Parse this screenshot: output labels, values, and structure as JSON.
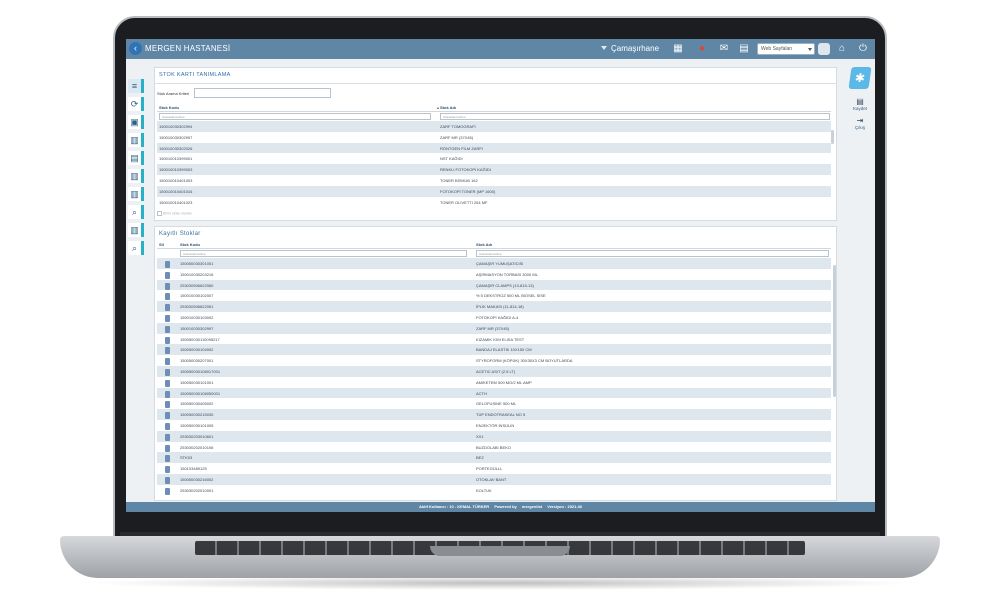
{
  "app": {
    "title": "MERGEN HASTANESİ",
    "department": "Çamaşırhane",
    "service_placeholder": "Web Sayfaları"
  },
  "toolbar": {
    "icons": [
      "calendar-icon",
      "user-icon",
      "mail-icon",
      "chart-icon",
      "home-icon",
      "power-icon"
    ]
  },
  "rightbar": {
    "save_label": "Kaydet",
    "exit_label": "Çıkış"
  },
  "define_panel": {
    "title": "STOK KARTI TANIMLAMA",
    "search_label": "Stok Arama Kriteri",
    "columns": [
      "Stok Kodu",
      "Stok Adı"
    ],
    "filter_placeholder": "Aranacak Kelime",
    "rows": [
      [
        "150010030302994",
        "ZARF TOMOGRAFİ"
      ],
      [
        "150010030302997",
        "ZARF MR (37X45)"
      ],
      [
        "150010030302026",
        "RÖNTGEN FİLM ZARFI"
      ],
      [
        "150010010399001",
        "NST KAĞIDI"
      ],
      [
        "150010010399003",
        "RENKLİ FOTOKOPİ KAĞIDI"
      ],
      [
        "150010010401003",
        "TONER BİSHUB 162"
      ],
      [
        "150010010401016",
        "FOTOKOPİ TONER (MP 1600)"
      ],
      [
        "150010010401023",
        "TONER OLIVETTI 254 MF"
      ]
    ],
    "footer_checkbox": "Birim stoku olanlar"
  },
  "registered_panel": {
    "title": "Kayıtlı Stoklar",
    "columns": [
      "Sil",
      "Stok Kodu",
      "Stok Adı"
    ],
    "filter_placeholder": "Aranacak Kelime",
    "rows": [
      [
        "150050030301001",
        "ÇAMAŞIR YUMUŞATICISI"
      ],
      [
        "150010030203216",
        "AŞIRMASYON TORBASI 3000 ML"
      ],
      [
        "253030506622060",
        "ÇAMAŞIR CLAMPS (13-815-13)"
      ],
      [
        "150010030102007",
        "% 5 DEKSTROZ 500 ML BIOSEL SISE"
      ],
      [
        "253030506622051",
        "İPLİK MAKASI (11-814-18)"
      ],
      [
        "150010030103002",
        "FOTOKOPİ KAĞIDI A-4"
      ],
      [
        "150010030302997",
        "ZARF MR (37X45)"
      ],
      [
        "150050030110095217",
        "KIZAMIK IGM ELISA TEST"
      ],
      [
        "150050030104002",
        "BANDAJ ELASTİK 10X150 CM"
      ],
      [
        "150050030207001",
        "STYROFORM (KÖPÜK) 30X30X3 CM BOYUTLARDA"
      ],
      [
        "150050030108017001",
        "ACETIC ASIT (2.5 LT)"
      ],
      [
        "150050030101001",
        "AMIKETEM 500 MG/2 ML AMP"
      ],
      [
        "150050030108050001",
        "ACTH"
      ],
      [
        "150050030405002",
        "GELOFUSINE 500 ML"
      ],
      [
        "150050030215030",
        "TÜP ENDOTRAKEAL NO 5"
      ],
      [
        "150050030101005",
        "ENJEKTÖR İNSÜLİN"
      ],
      [
        "253030203010601",
        "XX1"
      ],
      [
        "253030202010106",
        "BUZDOLABI BEKO"
      ],
      [
        "STK03",
        "BEZ"
      ],
      [
        "150103489125",
        "PORTEGÜLLL"
      ],
      [
        "150050030216002",
        "OTOKLAV BANT"
      ],
      [
        "253030202010001",
        "KOLTUK"
      ]
    ]
  },
  "status": {
    "user_label": "Aktif Kullanıcı : 10 - KEMAL TÜRKER",
    "powered_label": "Powered by",
    "brand": "mergenlist",
    "version": "Versiyon : 2021.46"
  }
}
